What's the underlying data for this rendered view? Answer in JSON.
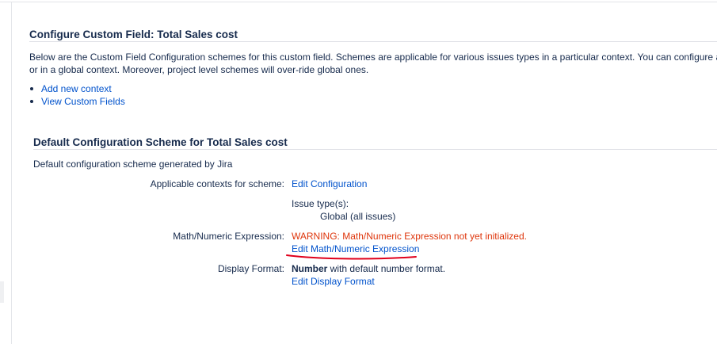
{
  "page": {
    "title": "Configure Custom Field: Total Sales cost",
    "description_line1": "Below are the Custom Field Configuration schemes for this custom field. Schemes are applicable for various issues types in a particular context. You can configure a custo",
    "description_line2": "or in a global context. Moreover, project level schemes will over-ride global ones.",
    "links": [
      "Add new context",
      "View Custom Fields"
    ]
  },
  "scheme": {
    "title": "Default Configuration Scheme for Total Sales cost",
    "description": "Default configuration scheme generated by Jira",
    "contexts_label": "Applicable contexts for scheme:",
    "edit_configuration": "Edit Configuration",
    "issue_types_label": "Issue type(s):",
    "issue_types_value": "Global (all issues)",
    "math_label": "Math/Numeric Expression:",
    "math_warning": "WARNING: Math/Numeric Expression not yet initialized.",
    "edit_math": "Edit Math/Numeric Expression",
    "display_label": "Display Format:",
    "display_format_bold": "Number",
    "display_format_rest": " with default number format.",
    "edit_display": "Edit Display Format"
  },
  "colors": {
    "link": "#0052cc",
    "warning": "#de350b",
    "annotation": "#e0001b"
  }
}
